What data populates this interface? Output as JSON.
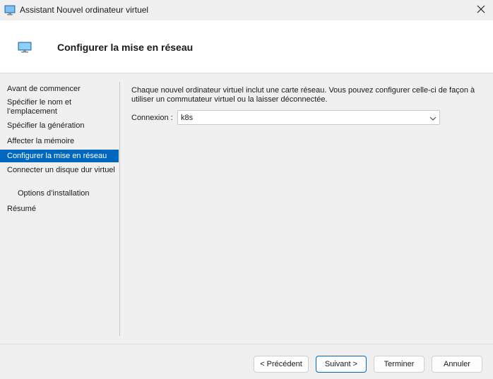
{
  "window": {
    "title": "Assistant Nouvel ordinateur virtuel",
    "icon": "monitor-icon"
  },
  "header": {
    "title": "Configurer la mise en réseau",
    "icon": "monitor-icon"
  },
  "nav": {
    "items": [
      {
        "label": "Avant de commencer",
        "active": false
      },
      {
        "label": "Spécifier le nom et l’emplacement",
        "active": false
      },
      {
        "label": "Spécifier la génération",
        "active": false
      },
      {
        "label": "Affecter la mémoire",
        "active": false
      },
      {
        "label": "Configurer la mise en réseau",
        "active": true
      },
      {
        "label": "Connecter un disque dur virtuel",
        "active": false
      },
      {
        "label": "Options d’installation",
        "active": false,
        "sub": true
      },
      {
        "label": "Résumé",
        "active": false
      }
    ]
  },
  "main": {
    "description": "Chaque nouvel ordinateur virtuel inclut une carte réseau. Vous pouvez configurer celle-ci de façon à utiliser un commutateur virtuel ou la laisser déconnectée.",
    "connection_label": "Connexion :",
    "connection_value": "k8s"
  },
  "footer": {
    "previous": "< Précédent",
    "next": "Suivant >",
    "finish": "Terminer",
    "cancel": "Annuler"
  },
  "colors": {
    "accent": "#0067c0",
    "background": "#f0f0f0",
    "header_background": "#ffffff"
  }
}
